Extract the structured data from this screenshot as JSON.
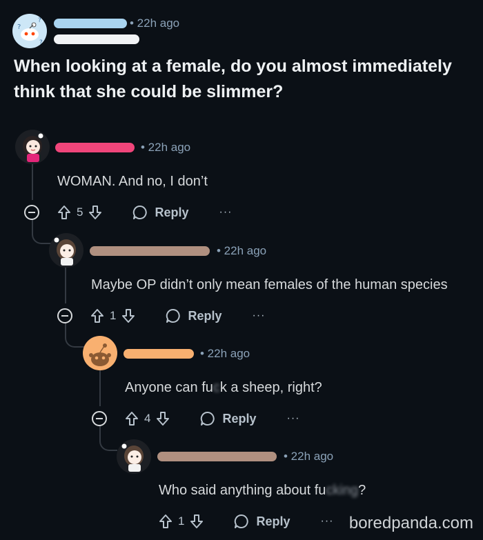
{
  "post": {
    "time": "• 22h ago",
    "title": "When looking at a female, do you almost immediately think that she could be slimmer?",
    "username_color": "#a9d4f0",
    "username2_color": "#f1f3f5"
  },
  "comments": [
    {
      "time": "• 22h ago",
      "text": "WOMAN. And no, I don’t",
      "score": "5",
      "reply_label": "Reply",
      "more": "···",
      "username_color": "#f0457a"
    },
    {
      "time": "• 22h ago",
      "text": "Maybe OP didn’t only mean females of the human species",
      "score": "1",
      "reply_label": "Reply",
      "more": "···",
      "username_color": "#b09080"
    },
    {
      "time": "• 22h ago",
      "text_a": "Anyone can fu",
      "text_censored": "c",
      "text_b": "k a sheep, right?",
      "score": "4",
      "reply_label": "Reply",
      "more": "···",
      "username_color": "#f8b070"
    },
    {
      "time": "• 22h ago",
      "text_a": "Who said anything about fu",
      "text_censored": "cking",
      "text_b": "?",
      "score": "1",
      "reply_label": "Reply",
      "more": "···",
      "username_color": "#b09080"
    }
  ],
  "watermark": "boredpanda.com"
}
